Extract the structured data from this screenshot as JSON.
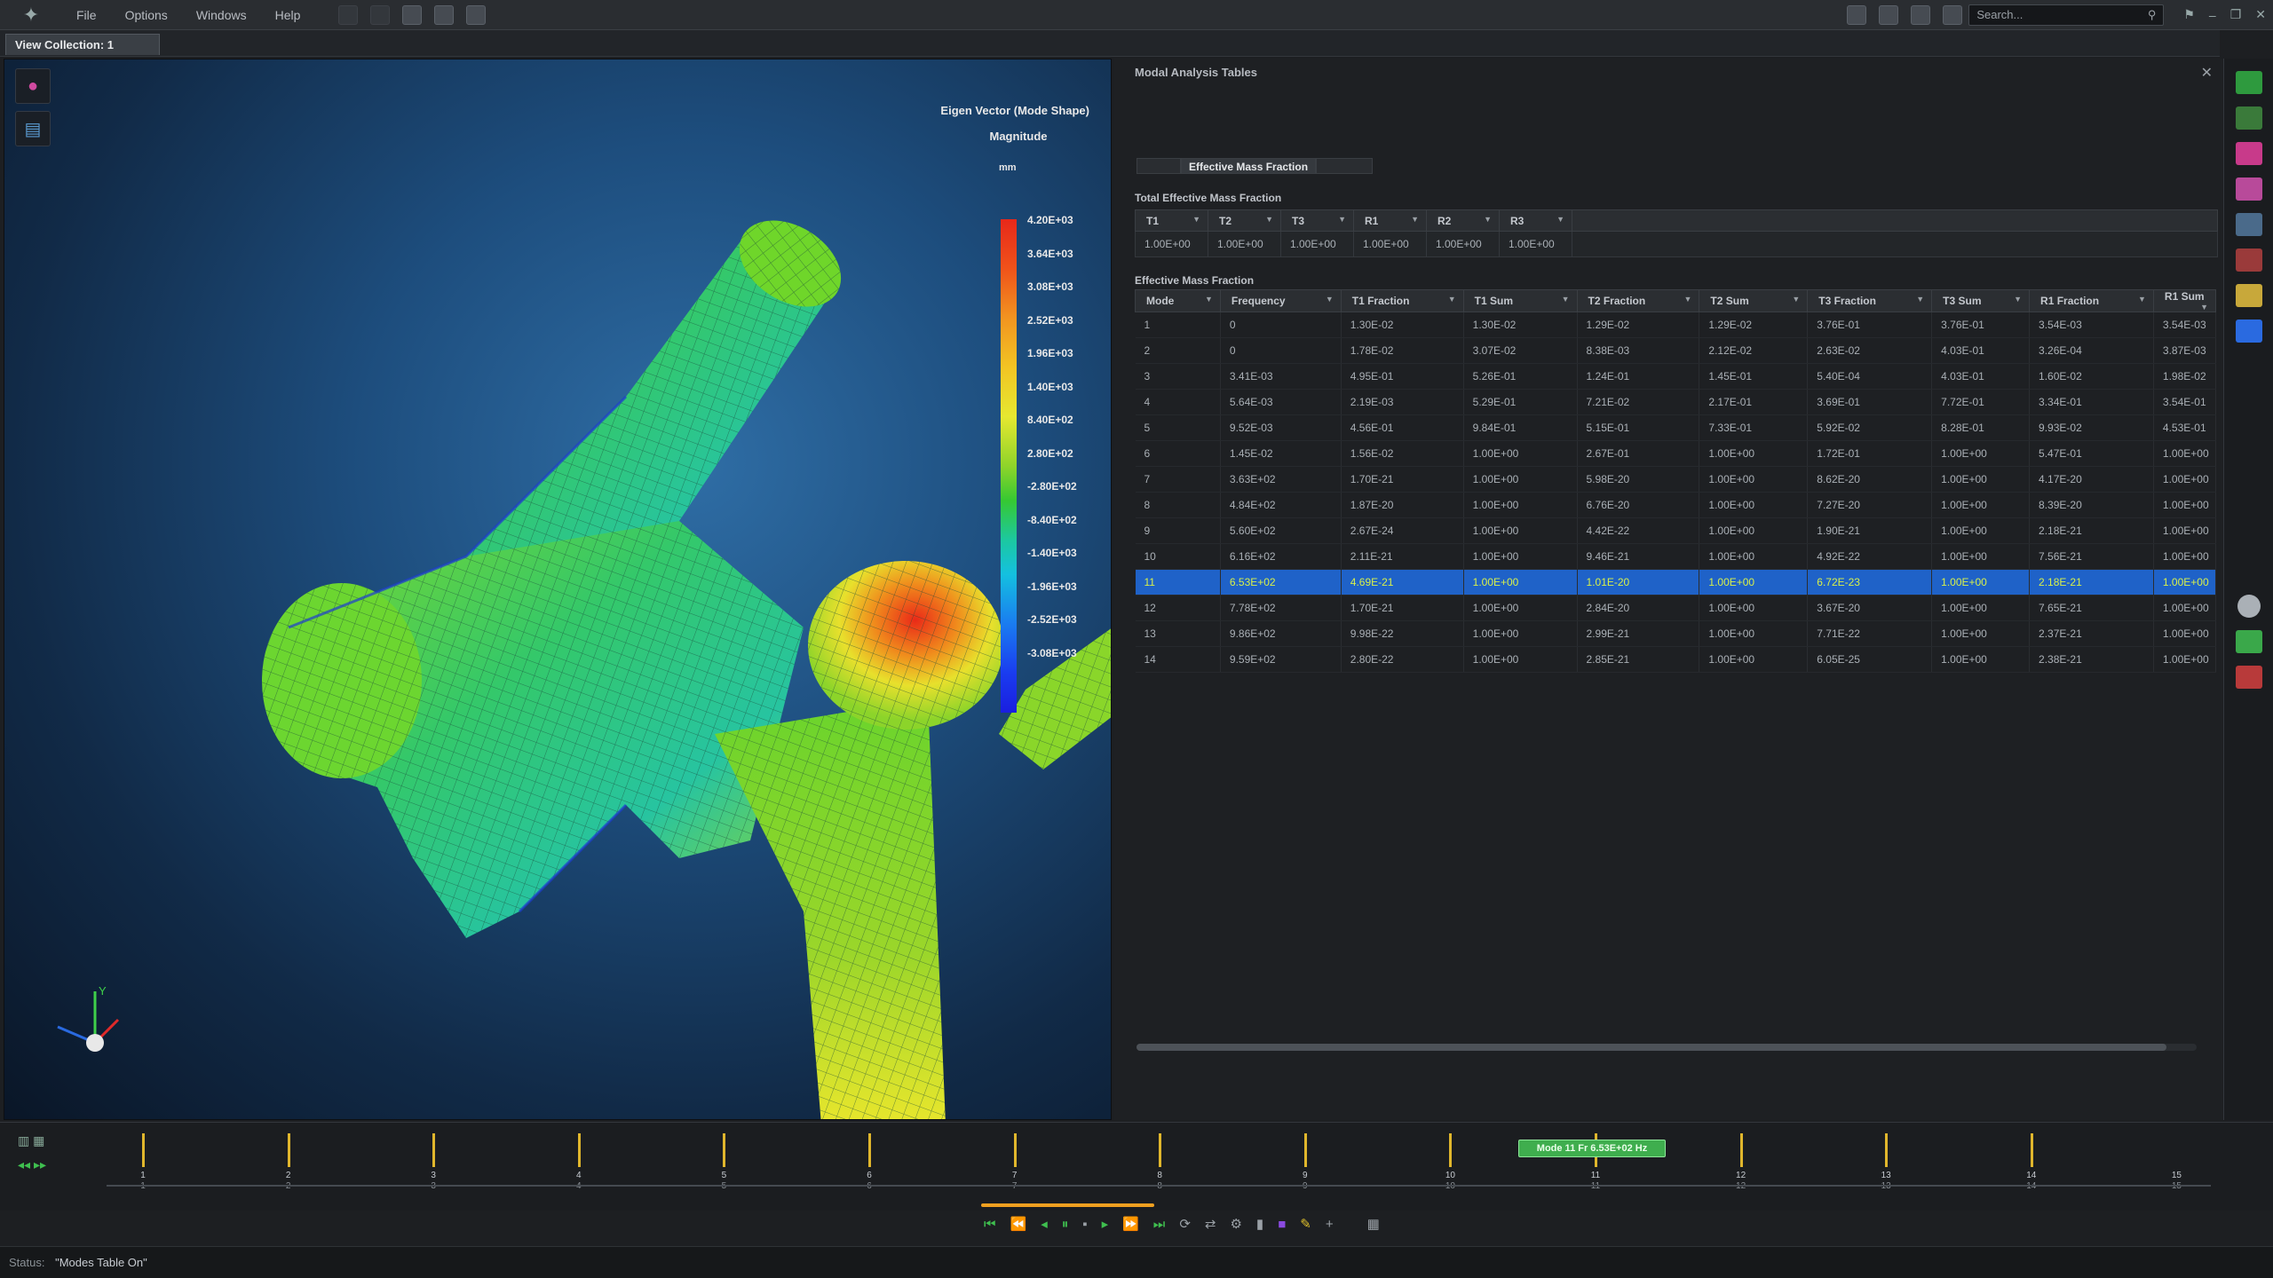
{
  "menubar": {
    "items": [
      "File",
      "Options",
      "Windows",
      "Help"
    ],
    "search_placeholder": "Search..."
  },
  "view_tab": "View Collection: 1",
  "legend": {
    "title": "Eigen Vector (Mode Shape)",
    "subtitle": "Magnitude",
    "unit": "mm",
    "labels": [
      "4.20E+03",
      "3.64E+03",
      "3.08E+03",
      "2.52E+03",
      "1.96E+03",
      "1.40E+03",
      "8.40E+02",
      "2.80E+02",
      "-2.80E+02",
      "-8.40E+02",
      "-1.40E+03",
      "-1.96E+03",
      "-2.52E+03",
      "-3.08E+03"
    ]
  },
  "axis_labels": {
    "y": "Y"
  },
  "panel": {
    "title": "Modal Analysis Tables",
    "active_tab": "Effective Mass Fraction",
    "section_total": "Total Effective Mass Fraction",
    "section_emf": "Effective Mass Fraction"
  },
  "total_table": {
    "headers": [
      "T1",
      "T2",
      "T3",
      "R1",
      "R2",
      "R3"
    ],
    "values": [
      "1.00E+00",
      "1.00E+00",
      "1.00E+00",
      "1.00E+00",
      "1.00E+00",
      "1.00E+00"
    ]
  },
  "emf_table": {
    "headers": [
      "Mode",
      "Frequency",
      "T1 Fraction",
      "T1 Sum",
      "T2 Fraction",
      "T2 Sum",
      "T3 Fraction",
      "T3 Sum",
      "R1 Fraction",
      "R1 Sum"
    ],
    "selected_row": 10,
    "rows": [
      [
        "1",
        "0",
        "1.30E-02",
        "1.30E-02",
        "1.29E-02",
        "1.29E-02",
        "3.76E-01",
        "3.76E-01",
        "3.54E-03",
        "3.54E-03"
      ],
      [
        "2",
        "0",
        "1.78E-02",
        "3.07E-02",
        "8.38E-03",
        "2.12E-02",
        "2.63E-02",
        "4.03E-01",
        "3.26E-04",
        "3.87E-03"
      ],
      [
        "3",
        "3.41E-03",
        "4.95E-01",
        "5.26E-01",
        "1.24E-01",
        "1.45E-01",
        "5.40E-04",
        "4.03E-01",
        "1.60E-02",
        "1.98E-02"
      ],
      [
        "4",
        "5.64E-03",
        "2.19E-03",
        "5.29E-01",
        "7.21E-02",
        "2.17E-01",
        "3.69E-01",
        "7.72E-01",
        "3.34E-01",
        "3.54E-01"
      ],
      [
        "5",
        "9.52E-03",
        "4.56E-01",
        "9.84E-01",
        "5.15E-01",
        "7.33E-01",
        "5.92E-02",
        "8.28E-01",
        "9.93E-02",
        "4.53E-01"
      ],
      [
        "6",
        "1.45E-02",
        "1.56E-02",
        "1.00E+00",
        "2.67E-01",
        "1.00E+00",
        "1.72E-01",
        "1.00E+00",
        "5.47E-01",
        "1.00E+00"
      ],
      [
        "7",
        "3.63E+02",
        "1.70E-21",
        "1.00E+00",
        "5.98E-20",
        "1.00E+00",
        "8.62E-20",
        "1.00E+00",
        "4.17E-20",
        "1.00E+00"
      ],
      [
        "8",
        "4.84E+02",
        "1.87E-20",
        "1.00E+00",
        "6.76E-20",
        "1.00E+00",
        "7.27E-20",
        "1.00E+00",
        "8.39E-20",
        "1.00E+00"
      ],
      [
        "9",
        "5.60E+02",
        "2.67E-24",
        "1.00E+00",
        "4.42E-22",
        "1.00E+00",
        "1.90E-21",
        "1.00E+00",
        "2.18E-21",
        "1.00E+00"
      ],
      [
        "10",
        "6.16E+02",
        "2.11E-21",
        "1.00E+00",
        "9.46E-21",
        "1.00E+00",
        "4.92E-22",
        "1.00E+00",
        "7.56E-21",
        "1.00E+00"
      ],
      [
        "11",
        "6.53E+02",
        "4.69E-21",
        "1.00E+00",
        "1.01E-20",
        "1.00E+00",
        "6.72E-23",
        "1.00E+00",
        "2.18E-21",
        "1.00E+00"
      ],
      [
        "12",
        "7.78E+02",
        "1.70E-21",
        "1.00E+00",
        "2.84E-20",
        "1.00E+00",
        "3.67E-20",
        "1.00E+00",
        "7.65E-21",
        "1.00E+00"
      ],
      [
        "13",
        "9.86E+02",
        "9.98E-22",
        "1.00E+00",
        "2.99E-21",
        "1.00E+00",
        "7.71E-22",
        "1.00E+00",
        "2.37E-21",
        "1.00E+00"
      ],
      [
        "14",
        "9.59E+02",
        "2.80E-22",
        "1.00E+00",
        "2.85E-21",
        "1.00E+00",
        "6.05E-25",
        "1.00E+00",
        "2.38E-21",
        "1.00E+00"
      ]
    ]
  },
  "timeline": {
    "ticks": [
      "1",
      "2",
      "3",
      "4",
      "5",
      "6",
      "7",
      "8",
      "9",
      "10",
      "11",
      "12",
      "13",
      "14",
      "15"
    ],
    "marker": "Mode 11 Fr 6.53E+02 Hz",
    "progress_fraction": 0.3
  },
  "status": {
    "label": "Status:",
    "value": "\"Modes Table On\""
  },
  "colors": {
    "accent": "#1f62c8",
    "marker_green": "#3fae4e",
    "tick_yellow": "#e0b62c"
  }
}
